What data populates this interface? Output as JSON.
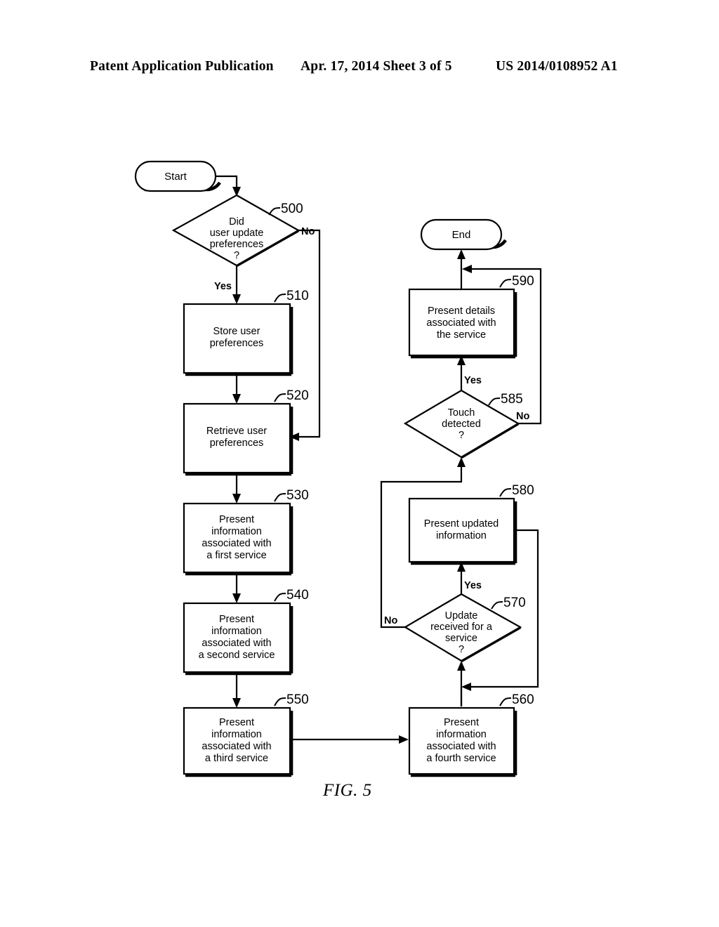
{
  "header": {
    "left": "Patent Application Publication",
    "middle": "Apr. 17, 2014  Sheet 3 of 5",
    "right": "US 2014/0108952 A1"
  },
  "figure": {
    "caption": "FIG. 5"
  },
  "flowchart": {
    "nodes": [
      {
        "id": "start",
        "type": "terminator",
        "ref": "",
        "lines": [
          "Start"
        ]
      },
      {
        "id": "n500",
        "type": "decision",
        "ref": "500",
        "lines": [
          "Did",
          "user update",
          "preferences",
          "?"
        ]
      },
      {
        "id": "n510",
        "type": "process",
        "ref": "510",
        "lines": [
          "Store user",
          "preferences"
        ]
      },
      {
        "id": "n520",
        "type": "process",
        "ref": "520",
        "lines": [
          "Retrieve user",
          "preferences"
        ]
      },
      {
        "id": "n530",
        "type": "process",
        "ref": "530",
        "lines": [
          "Present",
          "information",
          "associated with",
          "a first service"
        ]
      },
      {
        "id": "n540",
        "type": "process",
        "ref": "540",
        "lines": [
          "Present",
          "information",
          "associated with",
          "a second service"
        ]
      },
      {
        "id": "n550",
        "type": "process",
        "ref": "550",
        "lines": [
          "Present",
          "information",
          "associated with",
          "a third service"
        ]
      },
      {
        "id": "n560",
        "type": "process",
        "ref": "560",
        "lines": [
          "Present",
          "information",
          "associated with",
          "a fourth service"
        ]
      },
      {
        "id": "n570",
        "type": "decision",
        "ref": "570",
        "lines": [
          "Update",
          "received for a",
          "service",
          "?"
        ]
      },
      {
        "id": "n580",
        "type": "process",
        "ref": "580",
        "lines": [
          "Present updated",
          "information"
        ]
      },
      {
        "id": "n585",
        "type": "decision",
        "ref": "585",
        "lines": [
          "Touch",
          "detected",
          "?"
        ]
      },
      {
        "id": "n590",
        "type": "process",
        "ref": "590",
        "lines": [
          "Present details",
          "associated with",
          "the service"
        ]
      },
      {
        "id": "end",
        "type": "terminator",
        "ref": "",
        "lines": [
          "End"
        ]
      }
    ],
    "branch_labels": {
      "n500_yes": "Yes",
      "n500_no": "No",
      "n570_yes": "Yes",
      "n570_no": "No",
      "n585_yes": "Yes",
      "n585_no": "No"
    },
    "ref_numerals": [
      "500",
      "510",
      "520",
      "530",
      "540",
      "550",
      "560",
      "570",
      "580",
      "585",
      "590"
    ]
  },
  "colors": {
    "ink": "#000000",
    "paper": "#ffffff"
  }
}
